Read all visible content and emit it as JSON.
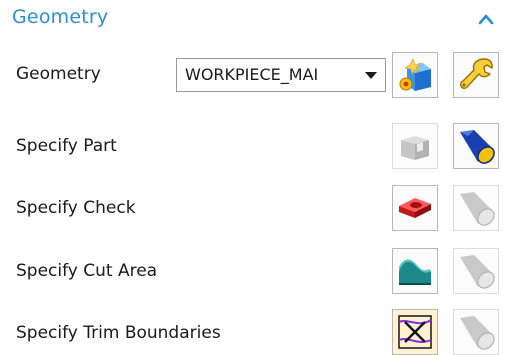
{
  "section": {
    "title": "Geometry",
    "collapse_icon": "chevron-up-icon",
    "accent_color": "#2b8fd6"
  },
  "geometry_row": {
    "label": "Geometry",
    "dropdown_value": "WORKPIECE_MAI",
    "buttons": [
      {
        "icon": "new-geometry-icon",
        "enabled": true
      },
      {
        "icon": "edit-wrench-icon",
        "enabled": true
      }
    ]
  },
  "rows": [
    {
      "label": "Specify Part",
      "select_icon": "part-geometry-icon",
      "select_enabled": false,
      "display_icon": "flashlight-icon",
      "display_enabled": true
    },
    {
      "label": "Specify Check",
      "select_icon": "check-geometry-icon",
      "select_enabled": true,
      "display_icon": "flashlight-icon",
      "display_enabled": false
    },
    {
      "label": "Specify Cut Area",
      "select_icon": "cut-area-icon",
      "select_enabled": true,
      "display_icon": "flashlight-icon",
      "display_enabled": false
    },
    {
      "label": "Specify Trim Boundaries",
      "select_icon": "trim-boundaries-icon",
      "select_enabled": true,
      "display_icon": "flashlight-icon",
      "display_enabled": false
    }
  ]
}
